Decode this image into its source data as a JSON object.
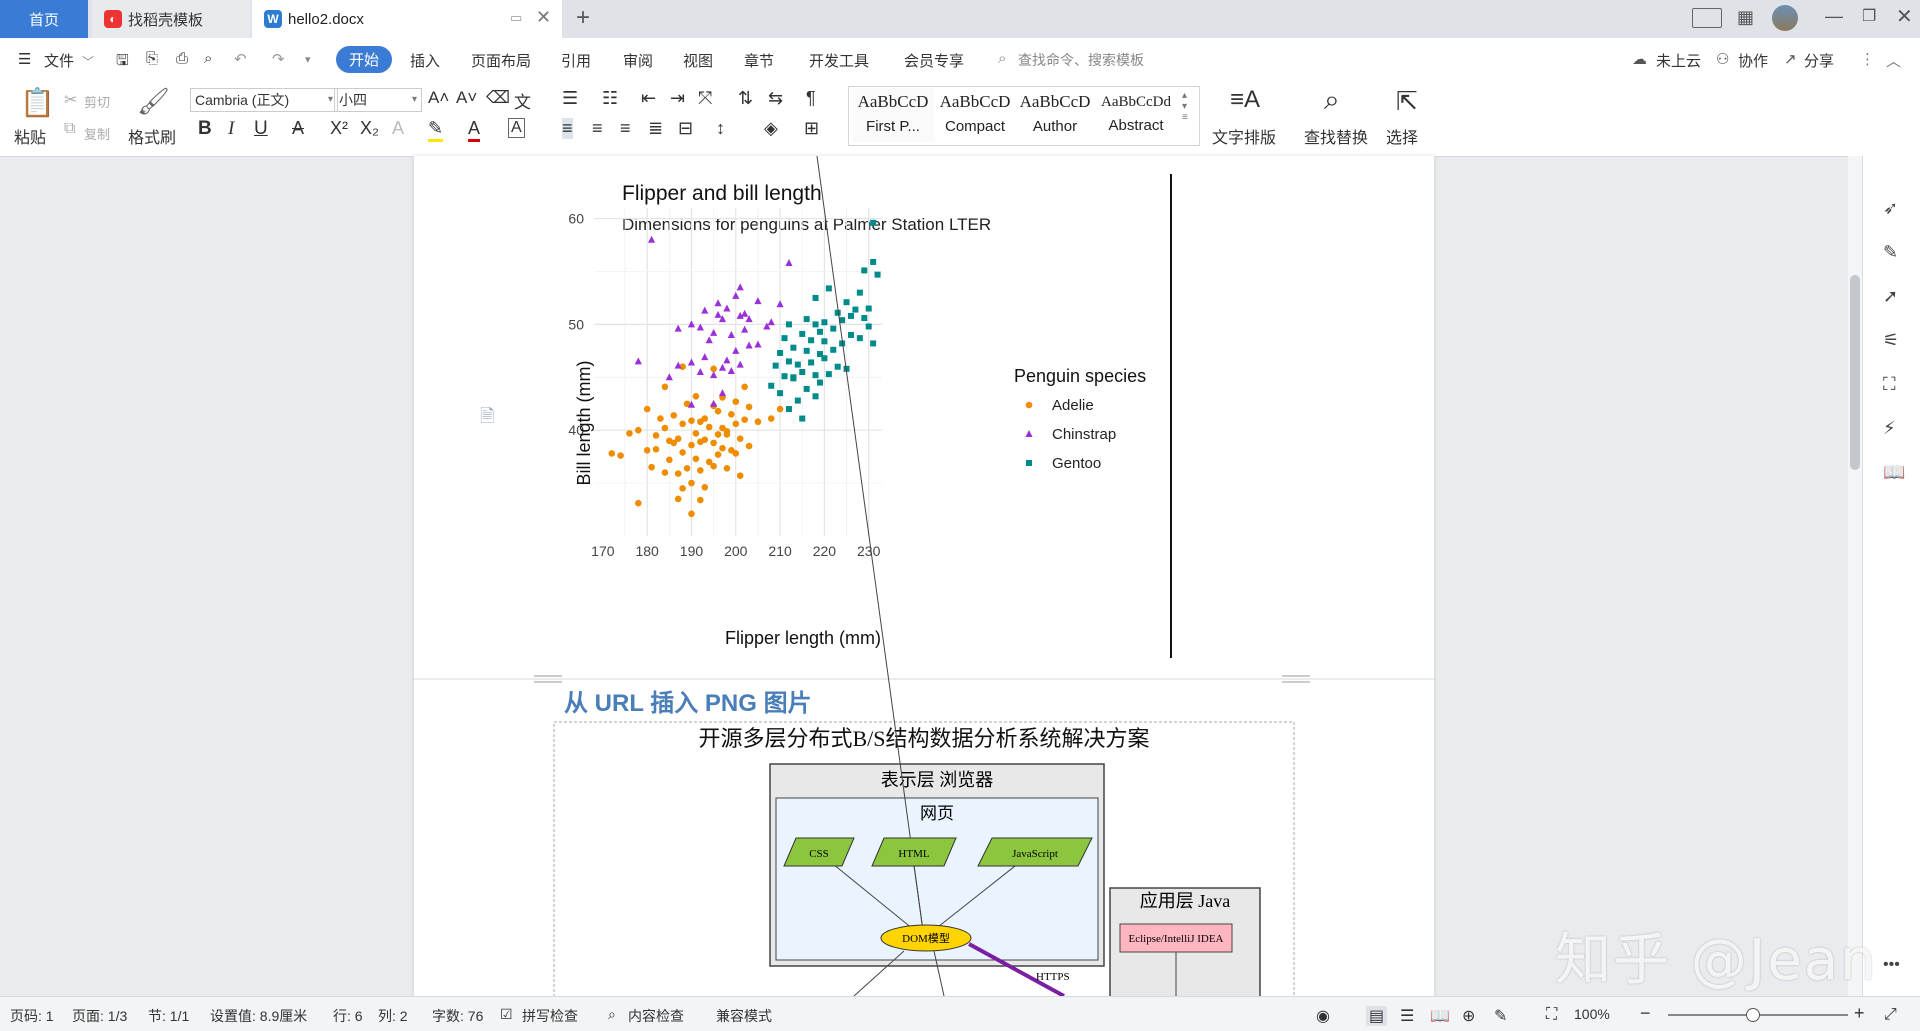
{
  "tabs": {
    "home": "首页",
    "template": "找稻壳模板",
    "document": "hello2.docx",
    "add": "+"
  },
  "menu": {
    "file": "文件",
    "items": [
      "开始",
      "插入",
      "页面布局",
      "引用",
      "审阅",
      "视图",
      "章节",
      "开发工具",
      "会员专享"
    ],
    "search_placeholder": "查找命令、搜索模板",
    "cloud": "未上云",
    "collab": "协作",
    "share": "分享"
  },
  "ribbon": {
    "paste": "粘贴",
    "cut": "剪切",
    "copy": "复制",
    "format_painter": "格式刷",
    "font": "Cambria (正文)",
    "size": "小四",
    "styles": [
      {
        "preview": "AaBbCcD",
        "name": "First P..."
      },
      {
        "preview": "AaBbCcD",
        "name": "Compact"
      },
      {
        "preview": "AaBbCcD",
        "name": "Author"
      },
      {
        "preview": "AaBbCcDd",
        "name": "Abstract"
      }
    ],
    "text_layout": "文字排版",
    "find_replace": "查找替换",
    "select": "选择"
  },
  "chart_data": {
    "type": "scatter",
    "title": "Flipper and bill length",
    "subtitle": "Dimensions for penguins at Palmer Station LTER",
    "xlabel": "Flipper length (mm)",
    "ylabel": "Bill length (mm)",
    "xlim": [
      168,
      233
    ],
    "ylim": [
      30,
      61
    ],
    "xticks": [
      170,
      180,
      190,
      200,
      210,
      220,
      230
    ],
    "yticks": [
      40,
      50,
      60
    ],
    "legend_title": "Penguin species",
    "legend_position": "right",
    "grid": true,
    "series": [
      {
        "name": "Adelie",
        "color": "#f08c00",
        "marker": "circle",
        "points": [
          [
            172,
            37.8
          ],
          [
            174,
            37.6
          ],
          [
            176,
            39.7
          ],
          [
            178,
            40.0
          ],
          [
            178,
            33.1
          ],
          [
            180,
            38.1
          ],
          [
            180,
            42.0
          ],
          [
            181,
            36.5
          ],
          [
            182,
            39.5
          ],
          [
            182,
            38.2
          ],
          [
            183,
            41.1
          ],
          [
            184,
            36.0
          ],
          [
            184,
            40.2
          ],
          [
            185,
            37.2
          ],
          [
            185,
            39.0
          ],
          [
            186,
            38.8
          ],
          [
            186,
            41.4
          ],
          [
            187,
            35.9
          ],
          [
            187,
            39.2
          ],
          [
            188,
            37.9
          ],
          [
            188,
            40.6
          ],
          [
            188,
            34.5
          ],
          [
            189,
            36.4
          ],
          [
            189,
            42.5
          ],
          [
            190,
            38.6
          ],
          [
            190,
            40.9
          ],
          [
            190,
            35.0
          ],
          [
            191,
            39.7
          ],
          [
            191,
            37.3
          ],
          [
            191,
            43.2
          ],
          [
            192,
            36.2
          ],
          [
            192,
            40.8
          ],
          [
            192,
            38.9
          ],
          [
            193,
            39.1
          ],
          [
            193,
            41.1
          ],
          [
            193,
            34.6
          ],
          [
            194,
            37.0
          ],
          [
            194,
            40.3
          ],
          [
            195,
            42.3
          ],
          [
            195,
            38.8
          ],
          [
            195,
            36.6
          ],
          [
            196,
            39.6
          ],
          [
            196,
            41.8
          ],
          [
            196,
            37.7
          ],
          [
            197,
            40.2
          ],
          [
            197,
            38.3
          ],
          [
            197,
            43.1
          ],
          [
            198,
            36.4
          ],
          [
            198,
            39.9
          ],
          [
            199,
            41.5
          ],
          [
            199,
            38.1
          ],
          [
            200,
            40.6
          ],
          [
            200,
            42.7
          ],
          [
            200,
            37.8
          ],
          [
            201,
            39.2
          ],
          [
            202,
            41.0
          ],
          [
            203,
            38.5
          ],
          [
            203,
            42.2
          ],
          [
            205,
            40.8
          ],
          [
            208,
            41.1
          ],
          [
            210,
            42.0
          ],
          [
            184,
            44.1
          ],
          [
            188,
            46.0
          ],
          [
            195,
            45.8
          ],
          [
            198,
            39.6
          ],
          [
            190,
            32.1
          ],
          [
            187,
            33.5
          ],
          [
            192,
            33.4
          ],
          [
            201,
            35.7
          ],
          [
            202,
            44.1
          ]
        ]
      },
      {
        "name": "Chinstrap",
        "color": "#9b30d9",
        "marker": "triangle",
        "points": [
          [
            178,
            46.5
          ],
          [
            181,
            58.0
          ],
          [
            185,
            45.0
          ],
          [
            187,
            46.1
          ],
          [
            187,
            49.6
          ],
          [
            190,
            46.4
          ],
          [
            190,
            50.0
          ],
          [
            192,
            45.5
          ],
          [
            192,
            49.7
          ],
          [
            193,
            46.9
          ],
          [
            193,
            51.3
          ],
          [
            194,
            48.5
          ],
          [
            195,
            49.2
          ],
          [
            195,
            45.2
          ],
          [
            196,
            50.9
          ],
          [
            196,
            52.0
          ],
          [
            197,
            50.5
          ],
          [
            197,
            45.9
          ],
          [
            198,
            51.5
          ],
          [
            198,
            46.6
          ],
          [
            199,
            49.0
          ],
          [
            200,
            52.7
          ],
          [
            200,
            47.5
          ],
          [
            201,
            50.8
          ],
          [
            201,
            53.5
          ],
          [
            202,
            49.5
          ],
          [
            202,
            51.0
          ],
          [
            203,
            50.5
          ],
          [
            205,
            52.2
          ],
          [
            205,
            48.1
          ],
          [
            207,
            49.8
          ],
          [
            208,
            50.2
          ],
          [
            210,
            51.9
          ],
          [
            212,
            55.8
          ],
          [
            190,
            42.4
          ],
          [
            195,
            42.5
          ],
          [
            197,
            43.5
          ],
          [
            199,
            45.6
          ],
          [
            201,
            46.2
          ],
          [
            203,
            48.0
          ]
        ]
      },
      {
        "name": "Gentoo",
        "color": "#008b8b",
        "marker": "square",
        "points": [
          [
            208,
            44.2
          ],
          [
            209,
            46.1
          ],
          [
            210,
            47.3
          ],
          [
            210,
            43.5
          ],
          [
            211,
            48.7
          ],
          [
            211,
            45.1
          ],
          [
            212,
            46.5
          ],
          [
            212,
            50.0
          ],
          [
            213,
            44.9
          ],
          [
            213,
            47.8
          ],
          [
            214,
            42.8
          ],
          [
            214,
            46.2
          ],
          [
            215,
            49.1
          ],
          [
            215,
            45.5
          ],
          [
            216,
            47.5
          ],
          [
            216,
            43.9
          ],
          [
            216,
            50.5
          ],
          [
            217,
            46.4
          ],
          [
            217,
            48.5
          ],
          [
            218,
            45.2
          ],
          [
            218,
            50.0
          ],
          [
            218,
            52.5
          ],
          [
            219,
            47.2
          ],
          [
            219,
            49.3
          ],
          [
            219,
            44.5
          ],
          [
            220,
            46.8
          ],
          [
            220,
            50.2
          ],
          [
            220,
            48.4
          ],
          [
            221,
            53.4
          ],
          [
            221,
            45.3
          ],
          [
            222,
            49.6
          ],
          [
            222,
            47.6
          ],
          [
            223,
            51.1
          ],
          [
            223,
            46.0
          ],
          [
            224,
            50.4
          ],
          [
            224,
            48.2
          ],
          [
            225,
            52.1
          ],
          [
            225,
            45.8
          ],
          [
            226,
            50.8
          ],
          [
            226,
            49.0
          ],
          [
            227,
            51.4
          ],
          [
            228,
            53.0
          ],
          [
            228,
            48.7
          ],
          [
            229,
            50.6
          ],
          [
            229,
            55.1
          ],
          [
            230,
            49.8
          ],
          [
            230,
            51.5
          ],
          [
            231,
            59.6
          ],
          [
            231,
            55.9
          ],
          [
            231,
            48.2
          ],
          [
            232,
            54.7
          ],
          [
            212,
            42.0
          ],
          [
            215,
            41.1
          ],
          [
            218,
            43.2
          ],
          [
            213,
            45.0
          ]
        ]
      }
    ]
  },
  "doc": {
    "heading": "从 URL 插入 PNG 图片",
    "diagram": {
      "title": "开源多层分布式B/S结构数据分析系统解决方案",
      "presentation": "表示层 浏览器",
      "webpage": "网页",
      "css": "CSS",
      "html": "HTML",
      "js": "JavaScript",
      "dom": "DOM模型",
      "https": "HTTPS",
      "app_layer": "应用层 Java",
      "ide": "Eclipse/IntelliJ IDEA"
    }
  },
  "status": {
    "page": "页码: 1",
    "pages": "页面: 1/3",
    "section": "节: 1/1",
    "setting": "设置值: 8.9厘米",
    "line": "行: 6",
    "col": "列: 2",
    "words": "字数: 76",
    "spell": "拼写检查",
    "content": "内容检查",
    "compat": "兼容模式",
    "zoom": "100%"
  },
  "watermark": "知乎 @Jean"
}
